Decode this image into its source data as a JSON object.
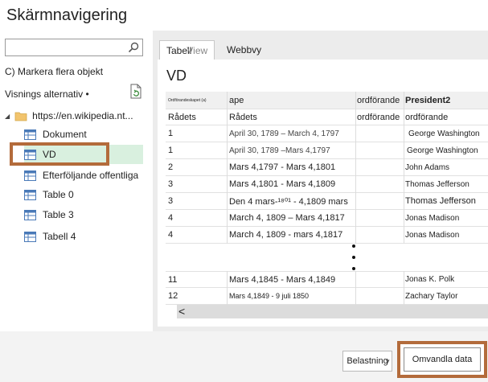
{
  "window": {
    "title": "Skärmnavigering"
  },
  "sidebar": {
    "search_value": "",
    "multi_select_label": "C) Markera flera objekt",
    "display_options_label": "Visnings alternativ •",
    "tree": [
      {
        "label": "https://en.wikipedia.nt...",
        "type": "folder"
      },
      {
        "label": "Dokument",
        "type": "table"
      },
      {
        "label": "VD",
        "type": "table",
        "selected": true
      },
      {
        "label": "Efterföljande offentliga",
        "type": "table"
      },
      {
        "label": "Table 0",
        "type": "table"
      },
      {
        "label": "Table 3",
        "type": "table"
      },
      {
        "label": "Tabell 4",
        "type": "table"
      }
    ]
  },
  "preview": {
    "tabs": {
      "table": "Tabell",
      "table_ghost": "View",
      "web": "Webbvy"
    },
    "heading": "VD",
    "columns": [
      "Ordförandeskapet (a)",
      "ape",
      "ordförande",
      "President2"
    ],
    "rows": [
      [
        "Rådets",
        "Rådets",
        "ordförande",
        "ordförande"
      ],
      [
        "1",
        "April 30, 1789 – March 4, 1797",
        "",
        "George Washington"
      ],
      [
        "1",
        "April 30, 1789 –Mars 4,1797",
        "",
        "George Washington"
      ],
      [
        "2",
        "Mars 4,1797 -   Mars 4,1801",
        "",
        "John Adams"
      ],
      [
        "3",
        "Mars 4,1801 -   Mars 4,1809",
        "",
        "Thomas Jefferson"
      ],
      [
        "3",
        "Den 4 mars-¹⁸⁰¹ - 4,1809 mars",
        "",
        "Thomas Jefferson"
      ],
      [
        "4",
        "March 4, 1809 – Mars 4,1817",
        "",
        "Jonas Madison"
      ],
      [
        "4",
        "March 4, 1809 - mars 4,1817",
        "",
        "Jonas Madison"
      ]
    ],
    "rows_bottom": [
      [
        "11",
        "Mars 4,1845 -   Mars 4,1849",
        "",
        "Jonas K. Polk"
      ],
      [
        "12",
        "Mars 4,1849 - 9 juli 1850",
        "",
        "Zachary   Taylor"
      ]
    ],
    "scroll_left": "<"
  },
  "footer": {
    "load_label": "Belastning",
    "transform_label": "Omvandla data"
  }
}
